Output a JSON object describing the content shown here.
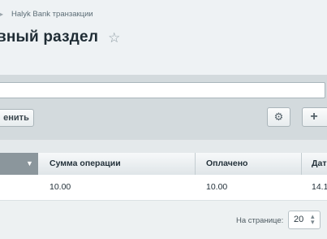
{
  "breadcrumb": {
    "item": "Halyk Bank транзакции"
  },
  "page": {
    "title": "вный раздел"
  },
  "toolbar": {
    "apply_label": "енить"
  },
  "grid": {
    "columns": [
      "Сумма операции",
      "Оплачено",
      "Дат"
    ],
    "rows": [
      {
        "amount": "10.00",
        "paid": "10.00",
        "date": "14.1"
      }
    ]
  },
  "footer": {
    "per_page_label": "На странице:",
    "per_page_value": "20"
  }
}
